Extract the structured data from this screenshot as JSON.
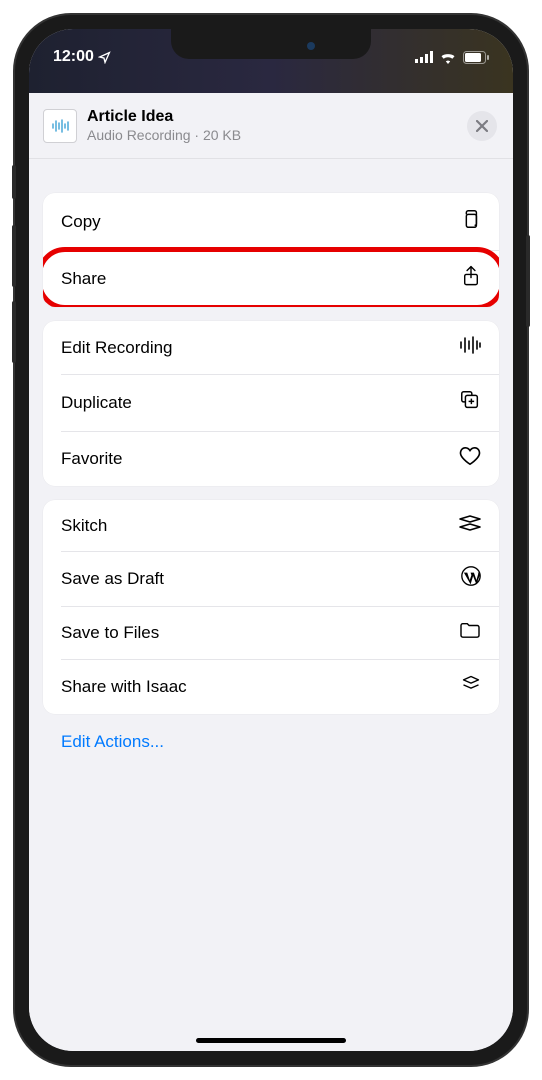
{
  "status": {
    "time": "12:00"
  },
  "header": {
    "title": "Article Idea",
    "subtitle": "Audio Recording · 20 KB"
  },
  "groups": [
    {
      "rows": [
        {
          "label": "Copy",
          "icon": "copy-icon",
          "highlighted": false
        },
        {
          "label": "Share",
          "icon": "share-icon",
          "highlighted": true
        }
      ]
    },
    {
      "rows": [
        {
          "label": "Edit Recording",
          "icon": "waveform-icon",
          "highlighted": false
        },
        {
          "label": "Duplicate",
          "icon": "duplicate-icon",
          "highlighted": false
        },
        {
          "label": "Favorite",
          "icon": "heart-icon",
          "highlighted": false
        }
      ]
    },
    {
      "rows": [
        {
          "label": "Skitch",
          "icon": "skitch-icon",
          "highlighted": false
        },
        {
          "label": "Save as Draft",
          "icon": "wordpress-icon",
          "highlighted": false
        },
        {
          "label": "Save to Files",
          "icon": "folder-icon",
          "highlighted": false
        },
        {
          "label": "Share with Isaac",
          "icon": "stack-icon",
          "highlighted": false
        }
      ]
    }
  ],
  "footer": {
    "edit_actions": "Edit Actions..."
  }
}
